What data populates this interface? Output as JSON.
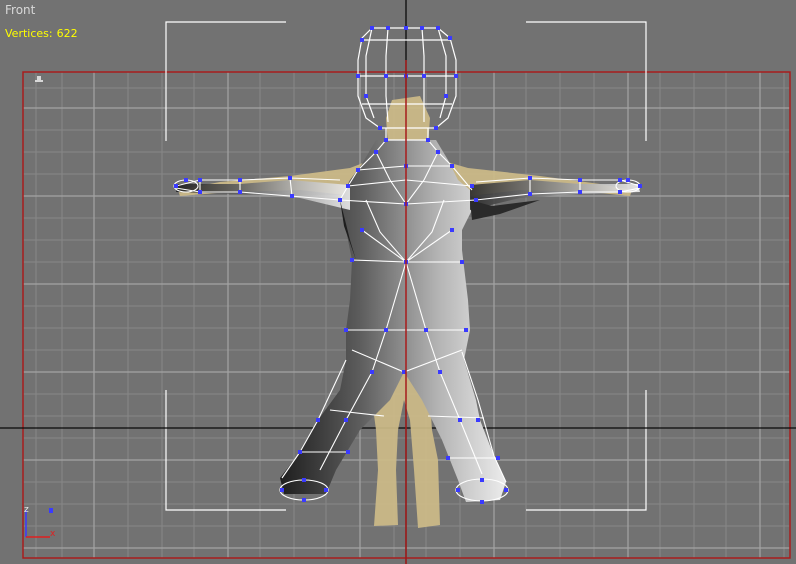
{
  "viewport": {
    "label": "Front",
    "stats_label": "Vertices:",
    "stats_value": "622"
  },
  "axis_tripod": {
    "x": "x",
    "z": "z"
  },
  "colors": {
    "background": "#727272",
    "grid": "#808080",
    "grid_major": "#a0a0a0",
    "frame_border": "#a81c1c",
    "world_axis": "#0a0a0a",
    "wireframe": "#ffffff",
    "vertex": "#3a3aff",
    "reference_image": "#cdbb88",
    "label_text": "#d8d8d8",
    "stats_text": "#ffff00"
  }
}
